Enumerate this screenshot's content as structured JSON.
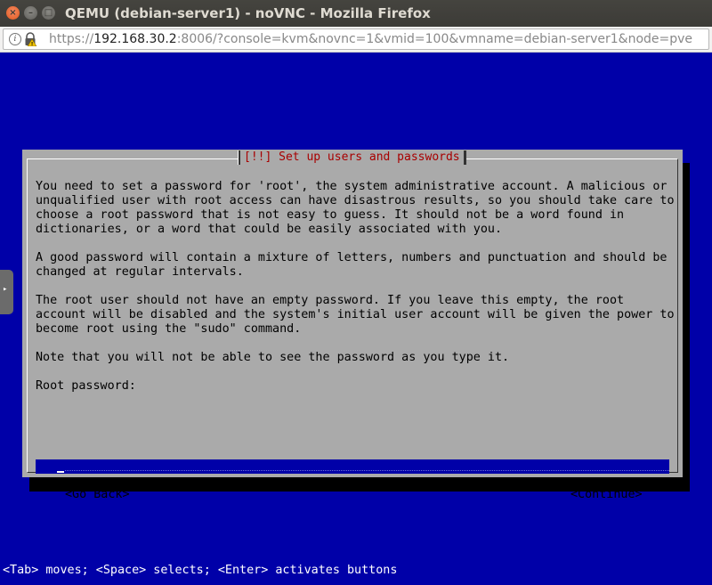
{
  "window": {
    "title": "QEMU (debian-server1) - noVNC - Mozilla Firefox",
    "close_glyph": "×",
    "min_glyph": "–",
    "max_glyph": "□"
  },
  "urlbar": {
    "scheme": "https://",
    "host": "192.168.30.2",
    "rest": ":8006/?console=kvm&novnc=1&vmid=100&vmname=debian-server1&node=pve",
    "info_glyph": "i"
  },
  "console": {
    "sidetab_glyph": "▸",
    "dialog": {
      "title": "[!!] Set up users and passwords",
      "paragraph1": "You need to set a password for 'root', the system administrative account. A malicious or\nunqualified user with root access can have disastrous results, so you should take care to\nchoose a root password that is not easy to guess. It should not be a word found in\ndictionaries, or a word that could be easily associated with you.",
      "paragraph2": "A good password will contain a mixture of letters, numbers and punctuation and should be\nchanged at regular intervals.",
      "paragraph3": "The root user should not have an empty password. If you leave this empty, the root\naccount will be disabled and the system's initial user account will be given the power to\nbecome root using the \"sudo\" command.",
      "paragraph4": "Note that you will not be able to see the password as you type it.",
      "password_label": "Root password:",
      "password_value": "***",
      "go_back": "<Go Back>",
      "continue": "<Continue>"
    },
    "hint": "<Tab> moves; <Space> selects; <Enter> activates buttons"
  },
  "colors": {
    "console_bg": "#0000a8",
    "dialog_bg": "#aaaaaa",
    "title_red": "#a80000",
    "text_white": "#ffffff"
  }
}
